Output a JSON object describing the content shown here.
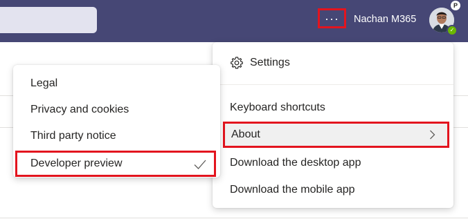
{
  "header": {
    "more_label": "···",
    "user_name": "Nachan M365",
    "badge_letter": "P",
    "presence_mark": "✓"
  },
  "menu": {
    "items": [
      {
        "label": "Settings",
        "icon": "gear-icon"
      },
      {
        "label": "Keyboard shortcuts"
      },
      {
        "label": "About",
        "icon": "chevron-right-icon"
      },
      {
        "label": "Download the desktop app"
      },
      {
        "label": "Download the mobile app"
      }
    ]
  },
  "about_submenu": {
    "items": [
      {
        "label": "Legal"
      },
      {
        "label": "Privacy and cookies"
      },
      {
        "label": "Third party notice"
      },
      {
        "label": "Developer preview",
        "checked": true,
        "icon": "checkmark-icon"
      }
    ]
  },
  "colors": {
    "header": "#464775",
    "highlight": "#e3141e",
    "presence": "#6bb700"
  }
}
